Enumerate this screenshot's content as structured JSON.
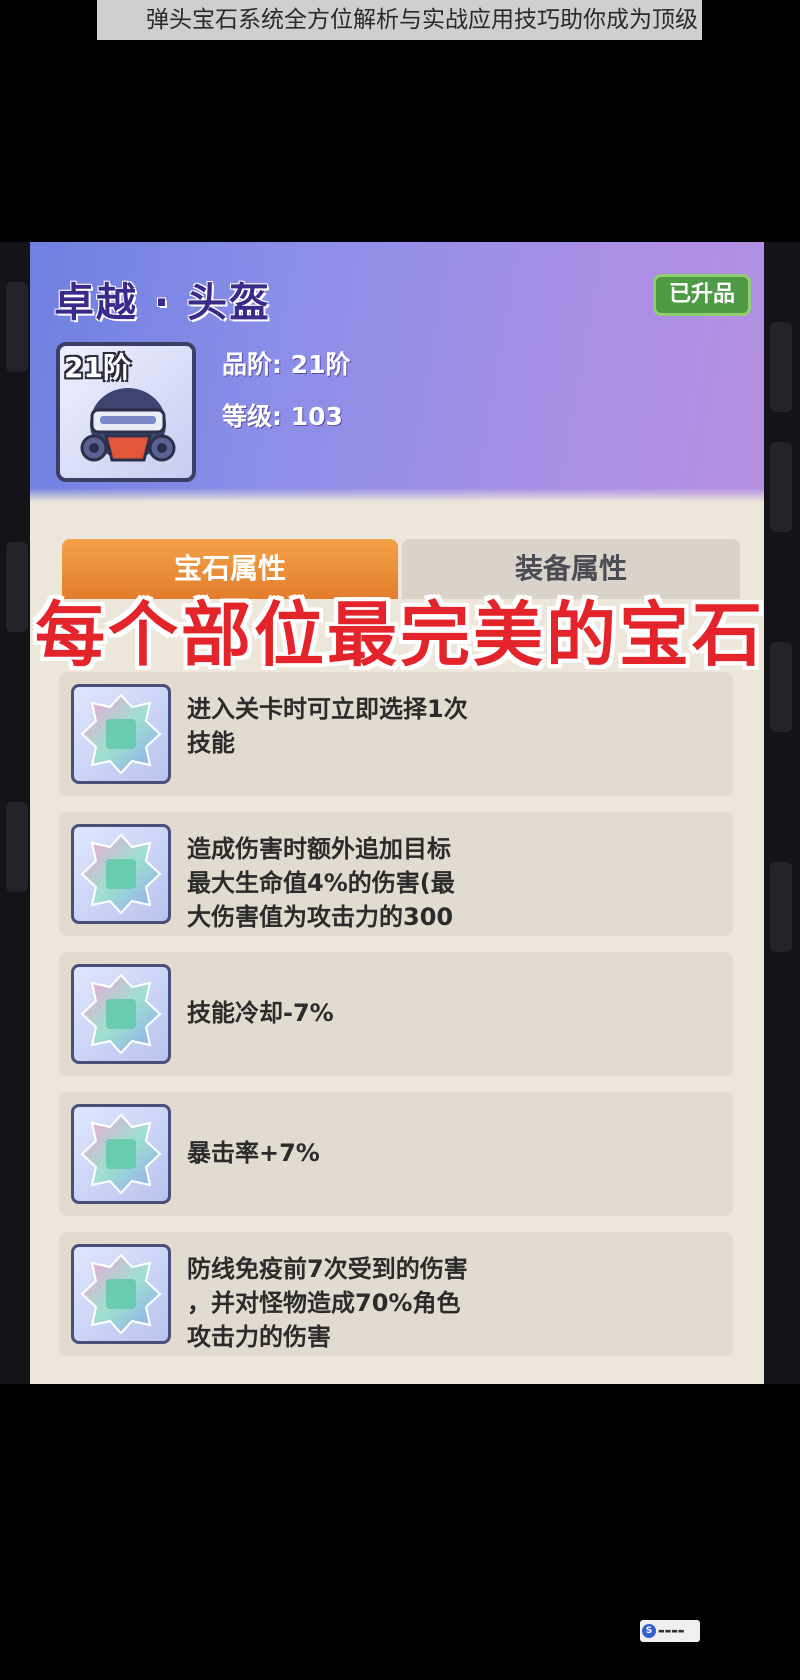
{
  "page": {
    "title": "弹头宝石系统全方位解析与实战应用技巧助你成为顶级"
  },
  "item": {
    "name": "卓越 · 头盔",
    "status_badge": "已升品",
    "tier_badge": "21阶",
    "icon": "helmet-icon",
    "stats": [
      {
        "text": "品阶: 21阶"
      },
      {
        "text": "等级: 103"
      }
    ]
  },
  "tabs": [
    {
      "label": "宝石属性",
      "active": true
    },
    {
      "label": "装备属性",
      "active": false
    }
  ],
  "overlay_caption": "每个部位最完美的宝石",
  "gems": [
    {
      "icon": "gem-icon",
      "text": "进入关卡时可立即选择1次\n技能"
    },
    {
      "icon": "gem-icon",
      "text": "造成伤害时额外追加目标\n最大生命值4%的伤害(最\n大伤害值为攻击力的300"
    },
    {
      "icon": "gem-icon",
      "text": "技能冷却-7%"
    },
    {
      "icon": "gem-icon",
      "text": "暴击率+7%"
    },
    {
      "icon": "gem-icon",
      "text": "防线免疫前7次受到的伤害\n，并对怪物造成70%角色\n攻击力的伤害"
    }
  ],
  "colors": {
    "header_gradient_start": "#6f7fe0",
    "header_gradient_end": "#b58fe2",
    "active_tab": "#f4a24a",
    "caption_red": "#e3252b",
    "badge_green": "#4f9a45"
  }
}
